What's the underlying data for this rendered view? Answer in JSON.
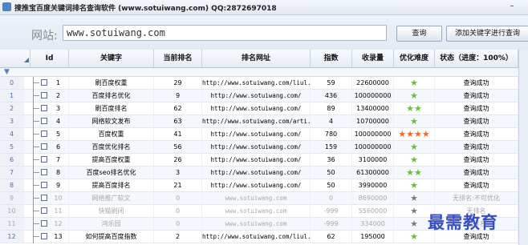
{
  "window": {
    "title": "搜推宝百度关键词排名查询软件 (www.sotuiwang.com) QQ:2872697018",
    "minimize_symbol": "–"
  },
  "urlbar": {
    "site_label": "网站:",
    "url_value": "www.sotuiwang.com",
    "query_button": "查询",
    "add_button": "添加关键字进行查询"
  },
  "table": {
    "columns": [
      "Id",
      "关键字",
      "当前排名",
      "排名网址",
      "指数",
      "收录量",
      "优化难度",
      "状态（进度：100%）"
    ],
    "rows": [
      {
        "row_num": "0",
        "id": "1",
        "keyword": "刷百度权重",
        "rank": "29",
        "url": "http://www.sotuiwang.com/liul...",
        "index": "59",
        "indexed": "22600000",
        "difficulty": {
          "stars": 1,
          "color": "green"
        },
        "status": "查询成功",
        "dim": false
      },
      {
        "row_num": "1",
        "id": "2",
        "keyword": "百度排名优化",
        "rank": "9",
        "url": "http://www.sotuiwang.com/",
        "index": "436",
        "indexed": "100000000",
        "difficulty": {
          "stars": 1,
          "color": "green"
        },
        "status": "查询成功",
        "dim": false
      },
      {
        "row_num": "2",
        "id": "3",
        "keyword": "刷百度排名",
        "rank": "62",
        "url": "http://www.sotuiwang.com/",
        "index": "89",
        "indexed": "13400000",
        "difficulty": {
          "stars": 2,
          "color": "green"
        },
        "status": "查询成功",
        "dim": false
      },
      {
        "row_num": "3",
        "id": "4",
        "keyword": "网络软文发布",
        "rank": "63",
        "url": "http://www.sotuiwang.com/arti...",
        "index": "4",
        "indexed": "10700000",
        "difficulty": {
          "stars": 1,
          "color": "green"
        },
        "status": "查询成功",
        "dim": false
      },
      {
        "row_num": "4",
        "id": "5",
        "keyword": "百度权重",
        "rank": "41",
        "url": "http://www.sotuiwang.com/",
        "index": "780",
        "indexed": "100000000",
        "difficulty": {
          "stars": 4,
          "color": "orange"
        },
        "status": "查询成功",
        "dim": false
      },
      {
        "row_num": "5",
        "id": "6",
        "keyword": "百度优化排名",
        "rank": "56",
        "url": "http://www.sotuiwang.com/",
        "index": "159",
        "indexed": "100000000",
        "difficulty": {
          "stars": 1,
          "color": "green"
        },
        "status": "查询成功",
        "dim": false
      },
      {
        "row_num": "6",
        "id": "7",
        "keyword": "提高百度权重",
        "rank": "26",
        "url": "http://www.sotuiwang.com/",
        "index": "36",
        "indexed": "3100000",
        "difficulty": {
          "stars": 1,
          "color": "green"
        },
        "status": "查询成功",
        "dim": false
      },
      {
        "row_num": "7",
        "id": "8",
        "keyword": "百度seo排名优化",
        "rank": "3",
        "url": "http://www.sotuiwang.com/",
        "index": "50",
        "indexed": "61300000",
        "difficulty": {
          "stars": 2,
          "color": "green"
        },
        "status": "查询成功",
        "dim": false
      },
      {
        "row_num": "8",
        "id": "9",
        "keyword": "提高百度排名",
        "rank": "21",
        "url": "http://www.sotuiwang.com/",
        "index": "50",
        "indexed": "3990000",
        "difficulty": {
          "stars": 1,
          "color": "green"
        },
        "status": "查询成功",
        "dim": false
      },
      {
        "row_num": "9",
        "id": "10",
        "keyword": "网络推广软文",
        "rank": "0",
        "url": "www.sotuiwang.com",
        "index": "0",
        "indexed": "8690000",
        "difficulty": {
          "stars": 1,
          "color": "grey"
        },
        "status": "无排名:不可优化",
        "dim": true
      },
      {
        "row_num": "10",
        "id": "11",
        "keyword": "快猫刷闭",
        "rank": "0",
        "url": "www.sotuiwang.com",
        "index": "-999",
        "indexed": "5560000",
        "difficulty": {
          "stars": 1,
          "color": "grey"
        },
        "status": "无排名",
        "dim": true
      },
      {
        "row_num": "11",
        "id": "12",
        "keyword": "鸿乐园",
        "rank": "0",
        "url": "www.sotuiwang.com",
        "index": "-999",
        "indexed": "334000",
        "difficulty": {
          "stars": 1,
          "color": "grey"
        },
        "status": "无排名",
        "dim": true
      },
      {
        "row_num": "12",
        "id": "13",
        "keyword": "如何提高百度指数",
        "rank": "2",
        "url": "http://www.sotuiwang.com/liul...",
        "index": "62",
        "indexed": "195000",
        "difficulty": {
          "stars": 1,
          "color": "green"
        },
        "status": "查询成功",
        "dim": false
      }
    ]
  },
  "watermark": "最需教育",
  "colors": {
    "star_green": "#66c040",
    "star_orange": "#f06b2a",
    "star_grey": "#7d7d7d",
    "header_accent": "#4a6fa5"
  }
}
